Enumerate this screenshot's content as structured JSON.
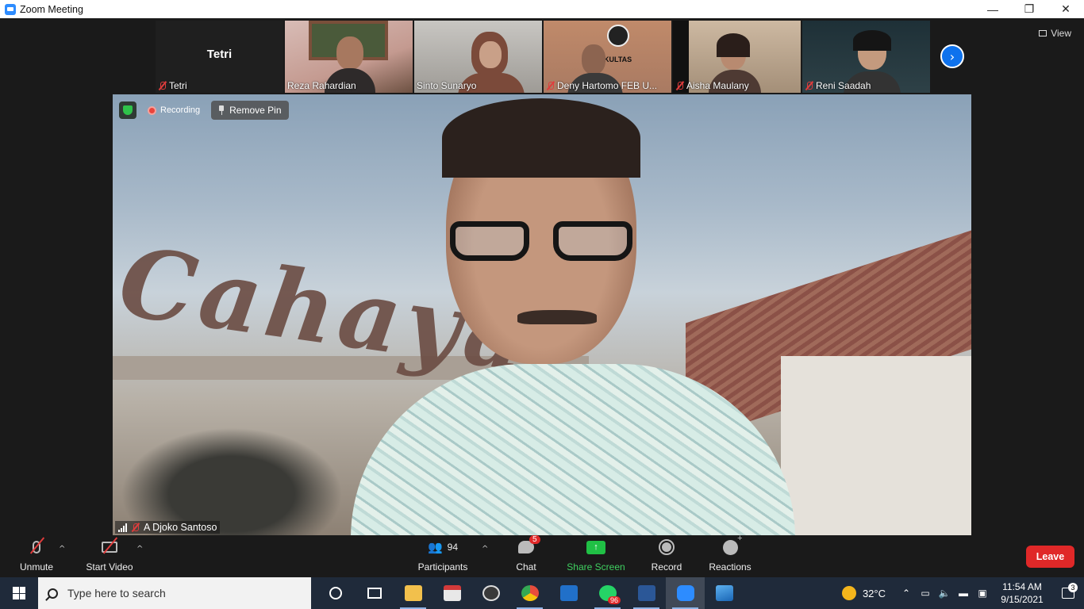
{
  "window": {
    "title": "Zoom Meeting",
    "minimize": "—",
    "restore": "❐",
    "close": "✕"
  },
  "gallery": {
    "self_tile": {
      "display_name": "Tetri",
      "label": "Tetri"
    },
    "tiles": [
      {
        "name": "Reza Rahardian",
        "muted": false,
        "bg": "#c9a79e"
      },
      {
        "name": "Sinto Sunaryo",
        "muted": false,
        "bg": "#a9a7a3"
      },
      {
        "name": "Deny Hartomo FEB U...",
        "muted": true,
        "bg": "#b58a6f"
      },
      {
        "name": "Aisha Maulany",
        "muted": true,
        "bg": "#b8a48f"
      },
      {
        "name": "Reni Saadah",
        "muted": true,
        "bg": "#2a3a3f"
      }
    ],
    "view_label": "View"
  },
  "main": {
    "speaker_name": "A Djoko Santoso",
    "recording_label": "Recording",
    "remove_pin_label": "Remove Pin",
    "background_sign_text": "Cahaya"
  },
  "toolbar": {
    "unmute": "Unmute",
    "start_video": "Start Video",
    "participants": "Participants",
    "participants_count": "94",
    "chat": "Chat",
    "chat_badge": "5",
    "share_screen": "Share Screen",
    "record": "Record",
    "reactions": "Reactions",
    "leave": "Leave",
    "caret": "^"
  },
  "taskbar": {
    "search_placeholder": "Type here to search",
    "whatsapp_badge": "96",
    "temperature": "32°C",
    "time": "11:54 AM",
    "date": "9/15/2021",
    "notification_count": "3"
  },
  "colors": {
    "zoom_blue": "#2d8cff",
    "share_green": "#20c045",
    "leave_red": "#e02828",
    "taskbar": "#1f2a3a"
  }
}
